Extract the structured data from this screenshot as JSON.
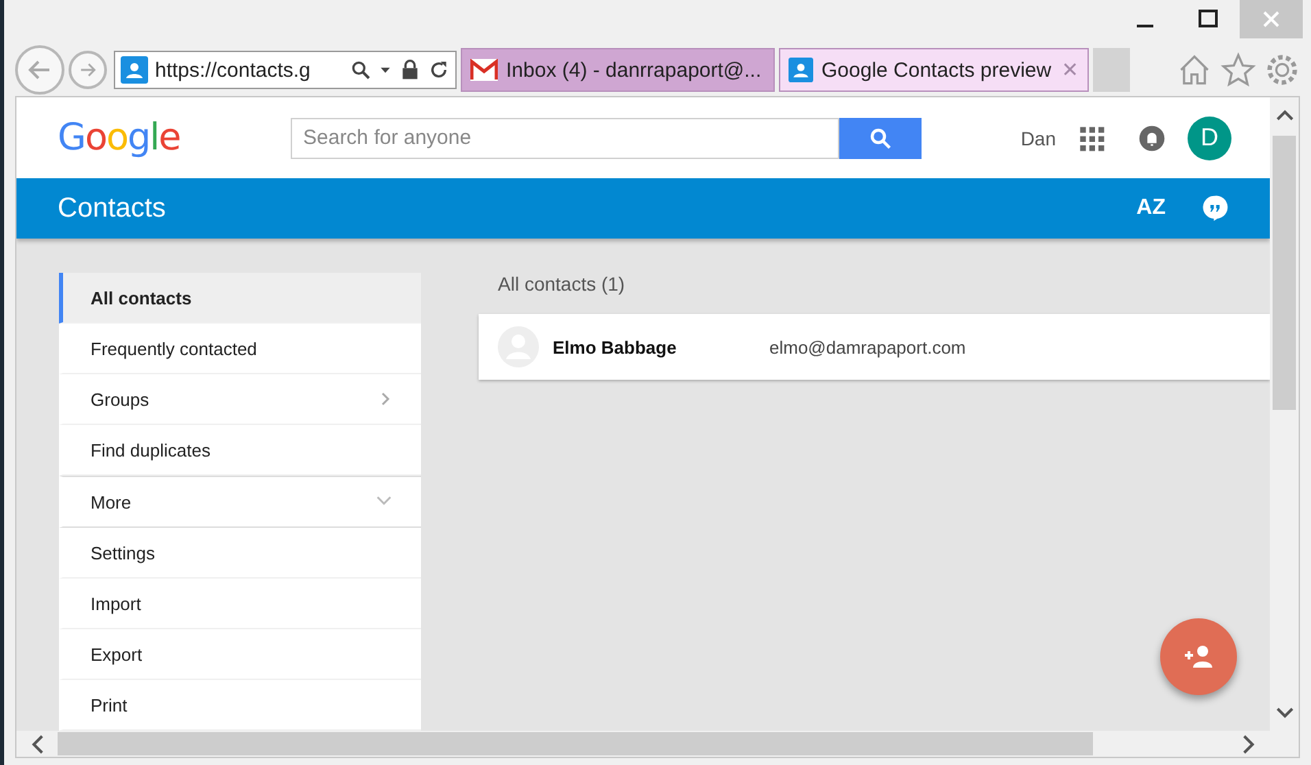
{
  "browser": {
    "address": "https://contacts.g",
    "tabs": [
      {
        "title": "Inbox (4) - danrrapaport@...",
        "kind": "mail",
        "selected": false
      },
      {
        "title": "Google Contacts preview",
        "kind": "contacts",
        "selected": true
      }
    ],
    "close_tab": "✕"
  },
  "header": {
    "logo": "Google",
    "search": {
      "placeholder": "Search for anyone"
    },
    "user": "Dan",
    "avatar": "D"
  },
  "appbar": {
    "title": "Contacts",
    "sort": "AZ"
  },
  "sidebar": {
    "items": [
      {
        "label": "All contacts",
        "selected": true,
        "kind": "plain"
      },
      {
        "label": "Frequently contacted",
        "selected": false,
        "kind": "plain"
      },
      {
        "label": "Groups",
        "selected": false,
        "kind": "submenu"
      },
      {
        "label": "Find duplicates",
        "selected": false,
        "kind": "plain"
      },
      {
        "label": "More",
        "selected": false,
        "kind": "expand",
        "expanded": false
      },
      {
        "label": "Settings",
        "selected": false,
        "kind": "plain"
      },
      {
        "label": "Import",
        "selected": false,
        "kind": "plain"
      },
      {
        "label": "Export",
        "selected": false,
        "kind": "plain"
      },
      {
        "label": "Print",
        "selected": false,
        "kind": "plain"
      }
    ]
  },
  "list": {
    "heading": "All contacts (1)",
    "contacts": [
      {
        "name": "Elmo Babbage",
        "email": "elmo@damrapaport.com"
      }
    ]
  }
}
